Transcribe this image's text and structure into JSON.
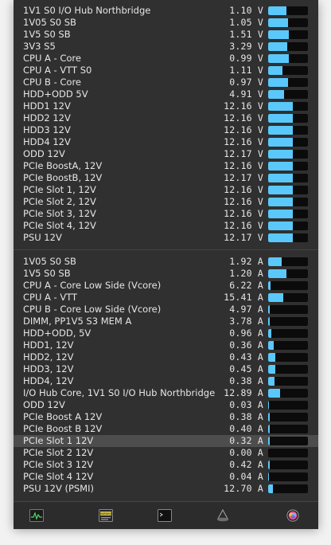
{
  "voltages": [
    {
      "label": "1V1 S0 I/O Hub Northbridge",
      "value": "1.10 V",
      "level": 0.45
    },
    {
      "label": "1V05 S0 SB",
      "value": "1.05 V",
      "level": 0.5
    },
    {
      "label": "1V5 S0 SB",
      "value": "1.51 V",
      "level": 0.52
    },
    {
      "label": "3V3 S5",
      "value": "3.29 V",
      "level": 0.48
    },
    {
      "label": "CPU A - Core",
      "value": "0.99 V",
      "level": 0.52
    },
    {
      "label": "CPU A - VTT S0",
      "value": "1.11 V",
      "level": 0.36
    },
    {
      "label": "CPU B - Core",
      "value": "0.97 V",
      "level": 0.5
    },
    {
      "label": "HDD+ODD 5V",
      "value": "4.91 V",
      "level": 0.4
    },
    {
      "label": "HDD1 12V",
      "value": "12.16 V",
      "level": 0.62
    },
    {
      "label": "HDD2 12V",
      "value": "12.16 V",
      "level": 0.62
    },
    {
      "label": "HDD3 12V",
      "value": "12.16 V",
      "level": 0.62
    },
    {
      "label": "HDD4 12V",
      "value": "12.16 V",
      "level": 0.62
    },
    {
      "label": "ODD 12V",
      "value": "12.17 V",
      "level": 0.62
    },
    {
      "label": "PCIe BoostA, 12V",
      "value": "12.16 V",
      "level": 0.62
    },
    {
      "label": "PCIe BoostB, 12V",
      "value": "12.17 V",
      "level": 0.62
    },
    {
      "label": "PCIe Slot 1, 12V",
      "value": "12.16 V",
      "level": 0.62
    },
    {
      "label": "PCIe Slot 2, 12V",
      "value": "12.16 V",
      "level": 0.62
    },
    {
      "label": "PCIe Slot 3, 12V",
      "value": "12.16 V",
      "level": 0.62
    },
    {
      "label": "PCIe Slot 4, 12V",
      "value": "12.16 V",
      "level": 0.62
    },
    {
      "label": "PSU 12V",
      "value": "12.17 V",
      "level": 0.62
    }
  ],
  "currents": [
    {
      "label": "1V05 S0 SB",
      "value": "1.92 A",
      "level": 0.34
    },
    {
      "label": "1V5 S0 SB",
      "value": "1.20 A",
      "level": 0.46
    },
    {
      "label": "CPU A - Core Low Side (Vcore)",
      "value": "6.22 A",
      "level": 0.05
    },
    {
      "label": "CPU A - VTT",
      "value": "15.41 A",
      "level": 0.38
    },
    {
      "label": "CPU B - Core Low Side (Vcore)",
      "value": "4.97 A",
      "level": 0.04
    },
    {
      "label": "DIMM, PP1V5 S3 MEM A",
      "value": "3.78 A",
      "level": 0.04
    },
    {
      "label": "HDD+ODD, 5V",
      "value": "0.96 A",
      "level": 0.08
    },
    {
      "label": "HDD1, 12V",
      "value": "0.36 A",
      "level": 0.14
    },
    {
      "label": "HDD2, 12V",
      "value": "0.43 A",
      "level": 0.17
    },
    {
      "label": "HDD3, 12V",
      "value": "0.45 A",
      "level": 0.18
    },
    {
      "label": "HDD4, 12V",
      "value": "0.38 A",
      "level": 0.15
    },
    {
      "label": "I/O Hub Core, 1V1 S0 I/O Hub Northbridge",
      "value": "12.89 A",
      "level": 0.3
    },
    {
      "label": "ODD 12V",
      "value": "0.03 A",
      "level": 0.02
    },
    {
      "label": "PCIe Boost A 12V",
      "value": "0.38 A",
      "level": 0.03
    },
    {
      "label": "PCIe Boost B 12V",
      "value": "0.40 A",
      "level": 0.03
    },
    {
      "label": "PCIe Slot 1 12V",
      "value": "0.32 A",
      "level": 0.03,
      "selected": true
    },
    {
      "label": "PCIe Slot 2 12V",
      "value": "0.00 A",
      "level": 0.0
    },
    {
      "label": "PCIe Slot 3 12V",
      "value": "0.42 A",
      "level": 0.03
    },
    {
      "label": "PCIe Slot 4 12V",
      "value": "0.04 A",
      "level": 0.01
    },
    {
      "label": "PSU 12V (PSMI)",
      "value": "12.70 A",
      "level": 0.12
    }
  ],
  "toolbar": {
    "icons": [
      "activity-monitor-icon",
      "console-warning-icon",
      "terminal-icon",
      "bluetooth-file-exchange-icon",
      "color-sync-icon"
    ],
    "console_icon_text": "WARNING"
  },
  "colors": {
    "accent": "#5ac8fa",
    "panel": "#303030"
  }
}
